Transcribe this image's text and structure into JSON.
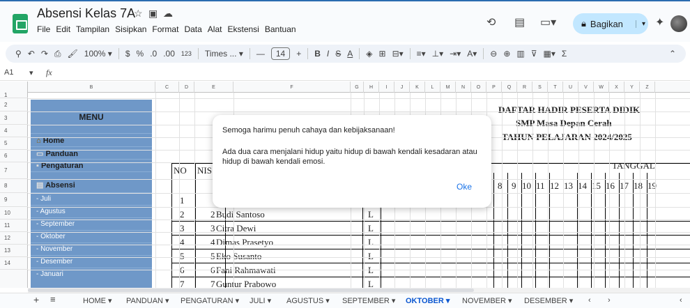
{
  "app": {
    "title": "Absensi Kelas 7A",
    "menus": [
      "File",
      "Edit",
      "Tampilan",
      "Sisipkan",
      "Format",
      "Data",
      "Alat",
      "Ekstensi",
      "Bantuan"
    ],
    "share_label": "Bagikan"
  },
  "toolbar": {
    "zoom": "100%",
    "currency": "$",
    "percent": "%",
    "dec_less": ".0",
    "dec_more": ".00",
    "number_format": "123",
    "font": "Times ...",
    "font_size": "14",
    "bold": "B",
    "italic": "I",
    "strike": "S",
    "text_color": "A",
    "sigma": "Σ"
  },
  "formula_bar": {
    "cell_ref": "A1",
    "fx": "fx"
  },
  "columns": [
    "B",
    "C",
    "D",
    "E",
    "F",
    "G",
    "H",
    "I",
    "J",
    "K",
    "L",
    "M",
    "N",
    "O",
    "P",
    "Q",
    "R",
    "S",
    "T",
    "U",
    "V",
    "W",
    "X",
    "Y",
    "Z"
  ],
  "rows": [
    "1",
    "2",
    "3",
    "4",
    "5",
    "6",
    "7",
    "8",
    "9",
    "10",
    "11",
    "12",
    "13",
    "14"
  ],
  "menu_panel": {
    "title": "MENU",
    "items": [
      "Home",
      "Panduan",
      "Pengaturan",
      "Absensi"
    ],
    "months": [
      "- Juli",
      "- Agustus",
      "- September",
      "- Oktober",
      "- November",
      "- Desember",
      "- Januari"
    ]
  },
  "sheet_titles": {
    "line1": "DAFTAR HADIR PESERTA DIDIK",
    "line2": "SMP Masa Depan Cerah",
    "line3": "TAHUN PELAJARAN 2024/2025",
    "tanggal": "TANGGAL"
  },
  "table": {
    "header_no": "NO",
    "header_nis": "NIS",
    "dates": [
      "8",
      "9",
      "10",
      "11",
      "12",
      "13",
      "14",
      "15",
      "16",
      "17",
      "18",
      "19"
    ],
    "students": [
      {
        "no": "1",
        "nis": "",
        "name": "",
        "gender": ""
      },
      {
        "no": "2",
        "nis": "2",
        "name": "Budi Santoso",
        "gender": "L"
      },
      {
        "no": "3",
        "nis": "3",
        "name": "Citra Dewi",
        "gender": "L"
      },
      {
        "no": "4",
        "nis": "4",
        "name": "Dimas Prasetyo",
        "gender": "L"
      },
      {
        "no": "5",
        "nis": "5",
        "name": "Eko Susanto",
        "gender": "L"
      },
      {
        "no": "6",
        "nis": "6",
        "name": "Fani Rahmawati",
        "gender": "L"
      },
      {
        "no": "7",
        "nis": "7",
        "name": "Guntur Prabowo",
        "gender": "L"
      }
    ]
  },
  "modal": {
    "title": "Semoga harimu penuh cahaya dan kebijaksanaan!",
    "body": "Ada dua cara menjalani hidup yaitu hidup di bawah kendali kesadaran atau hidup di bawah kendali emosi.",
    "ok": "Oke"
  },
  "tabs": [
    "HOME",
    "PANDUAN",
    "PENGATURAN",
    "JULI",
    "AGUSTUS",
    "SEPTEMBER",
    "OKTOBER",
    "NOVEMBER",
    "DESEMBER"
  ],
  "active_tab": "OKTOBER",
  "colors": {
    "accent": "#0b57d0",
    "menu_bg": "#6f98c8",
    "share_bg": "#c2e7ff",
    "sheets_green": "#23a566"
  }
}
